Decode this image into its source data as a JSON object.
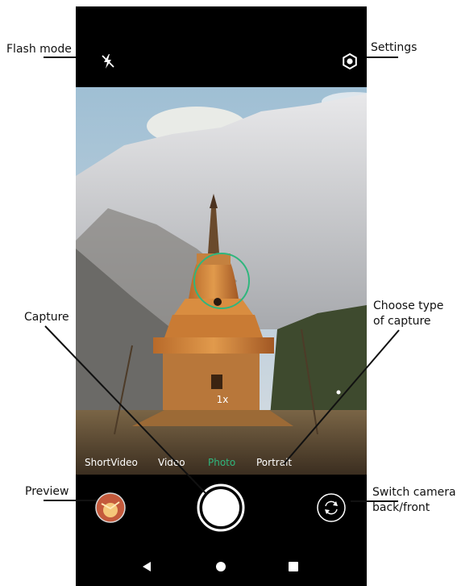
{
  "camera": {
    "zoom_label": "1x",
    "modes": [
      "ShortVideo",
      "Video",
      "Photo",
      "Portrait"
    ],
    "active_mode": "Photo"
  },
  "callouts": {
    "flash_mode": "Flash mode",
    "settings": "Settings",
    "capture": "Capture",
    "choose_type_line1": "Choose type",
    "choose_type_line2": "of capture",
    "preview": "Preview",
    "switch_line1": "Switch camera",
    "switch_line2": "back/front"
  },
  "colors": {
    "accent": "#2fb67d",
    "focus_ring": "#2fb67d",
    "bar": "#000000"
  },
  "icons": {
    "flash": "flash-off-icon",
    "settings": "settings-gear-icon",
    "shutter": "shutter-icon",
    "switch": "switch-camera-icon",
    "nav_back": "back-triangle-icon",
    "nav_home": "home-circle-icon",
    "nav_recents": "recents-square-icon"
  }
}
